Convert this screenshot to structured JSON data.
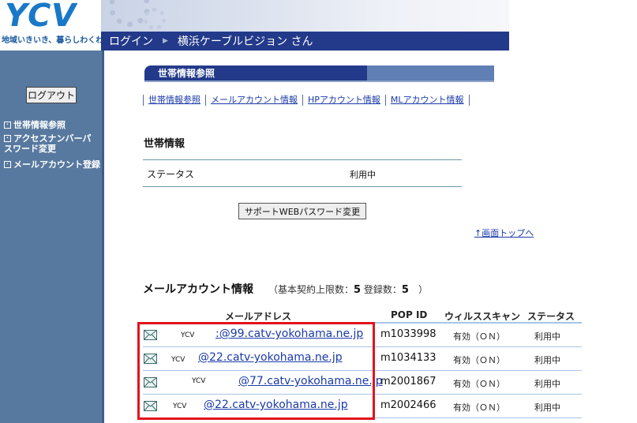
{
  "header": {
    "logo_text": "YCV",
    "tagline": "地域いきいき、暮らしわくわく",
    "nav_login": "ログイン",
    "nav_arrow": "▶",
    "nav_user": "横浜ケーブルビジョン さん"
  },
  "sidebar": {
    "logout_label": "ログアウト",
    "items": [
      {
        "label": "世帯情報参照"
      },
      {
        "label": "アクセスナンバーパスワード変更"
      },
      {
        "label": "メールアカウント登録"
      }
    ]
  },
  "section": {
    "title": "世帯情報参照"
  },
  "tabs": [
    {
      "label": "世帯情報参照"
    },
    {
      "label": "メールアカウント情報"
    },
    {
      "label": "HPアカウント情報"
    },
    {
      "label": "MLアカウント情報"
    }
  ],
  "household": {
    "title": "世帯情報",
    "status_label": "ステータス",
    "status_value": "利用中",
    "password_button": "サポートWEBパスワード変更",
    "top_link": "↑画面トップへ"
  },
  "mail": {
    "title": "メールアカウント情報",
    "meta_prefix": "（基本契約上限数：",
    "limit": "5",
    "meta_middle": " 登録数：",
    "registered": "5",
    "meta_suffix": "　）",
    "columns": {
      "address": "メールアドレス",
      "pop_id": "POP ID",
      "virus_scan": "ウィルススキャン",
      "status": "ステータス"
    },
    "rows": [
      {
        "ycv": "YCV",
        "address": ":@99.catv-yokohama.ne.jp",
        "pop_id": "m1033998",
        "virus": "有効（ＯＮ）",
        "status": "利用中"
      },
      {
        "ycv": "YCV",
        "address": "@22.catv-yokohama.ne.jp",
        "pop_id": "m1034133",
        "virus": "有効（ＯＮ）",
        "status": "利用中"
      },
      {
        "ycv": "YCV",
        "address": "@77.catv-yokohama.ne.jp",
        "pop_id": "m2001867",
        "virus": "有効（ＯＮ）",
        "status": "利用中"
      },
      {
        "ycv": "YCV",
        "address": "@22.catv-yokohama.ne.jp",
        "pop_id": "m2002466",
        "virus": "有効（ＯＮ）",
        "status": "利用中"
      }
    ]
  },
  "colors": {
    "nav_bar": "#233a8a",
    "sidebar": "#58799f",
    "logo": "#1a78c8",
    "link": "#1a3aa8",
    "highlight": "#e0141c"
  }
}
